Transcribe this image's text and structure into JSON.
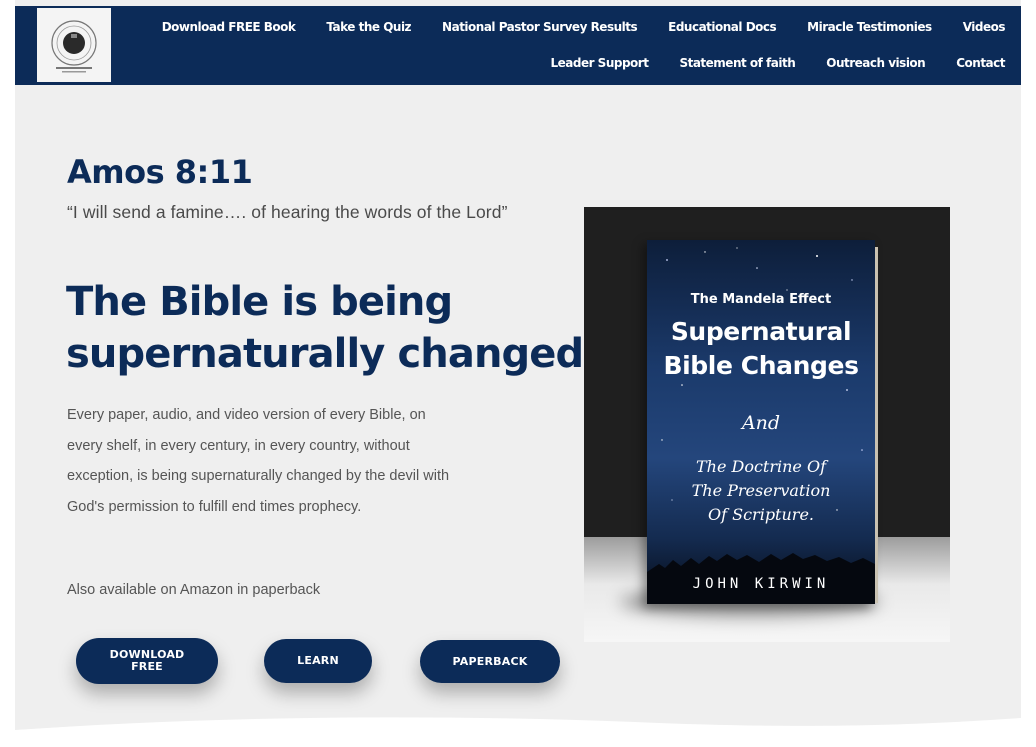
{
  "header": {
    "logo_label": "logo",
    "nav_row1": [
      "Download FREE Book",
      "Take the Quiz",
      "National Pastor Survey Results",
      "Educational Docs",
      "Miracle Testimonies",
      "Videos"
    ],
    "nav_row2": [
      "Leader Support",
      "Statement of faith",
      "Outreach vision",
      "Contact"
    ]
  },
  "hero": {
    "verse_ref": "Amos 8:11",
    "verse_text": "“I will send a famine…. of hearing the words of the Lord”",
    "headline": "The Bible is being supernaturally changed",
    "body": "Every paper, audio, and video version of every Bible, on every shelf, in every century, in every country, without exception, is being supernaturally changed by the devil with God's permission to fulfill end times prophecy.",
    "also_available": "Also available on Amazon in paperback"
  },
  "buttons": {
    "download": "DOWNLOAD FREE",
    "learn": "LEARN",
    "paperback": "PAPERBACK"
  },
  "book": {
    "small_title": "The Mandela Effect",
    "big_title_1": "Supernatural",
    "big_title_2": "Bible Changes",
    "and": "And",
    "doctrine_1": "The Doctrine Of",
    "doctrine_2": "The Preservation",
    "doctrine_3": "Of Scripture.",
    "author": "JOHN KIRWIN"
  },
  "colors": {
    "brand_navy": "#0c2b58",
    "page_bg": "#efefef",
    "body_text": "#555555"
  }
}
